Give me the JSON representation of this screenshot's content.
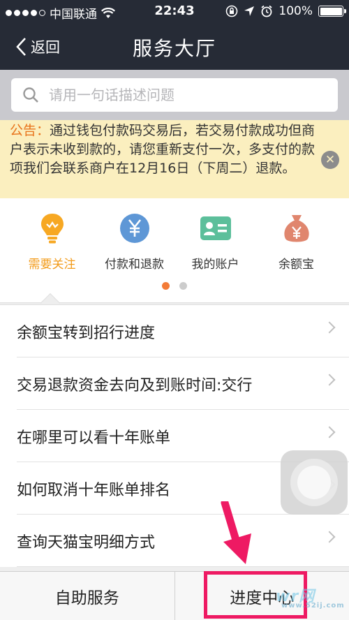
{
  "status_bar": {
    "carrier": "中国联通",
    "time": "22:43",
    "battery": "100%",
    "signal_dots": 5
  },
  "nav": {
    "back_label": "返回",
    "title": "服务大厅"
  },
  "search": {
    "placeholder": "请用一句话描述问题"
  },
  "notice": {
    "label": "公告：",
    "text": "通过钱包付款码交易后，若交易付款成功但商户表示未收到款的，请您重新支付一次，多支付的款项我们会联系商户在12月16日（下周二）退款。"
  },
  "categories": [
    {
      "label": "需要关注",
      "icon": "lightbulb-icon",
      "active": true
    },
    {
      "label": "付款和退款",
      "icon": "yuan-coin-icon",
      "active": false
    },
    {
      "label": "我的账户",
      "icon": "id-card-icon",
      "active": false
    },
    {
      "label": "余额宝",
      "icon": "money-bag-icon",
      "active": false
    }
  ],
  "pager": {
    "pages": 2,
    "current": 1
  },
  "list": [
    "余额宝转到招行进度",
    "交易退款资金去向及到账时间:交行",
    "在哪里可以看十年账单",
    "如何取消十年账单排名",
    "查询天猫宝明细方式"
  ],
  "tabs": {
    "self_service": "自助服务",
    "progress_center": "进度中心"
  },
  "watermark": {
    "text": "wr网",
    "sub": "www.52ij.com"
  },
  "colors": {
    "topbar": "#262b36",
    "accent_orange": "#f29b1a",
    "notice_bg": "#fbefbf",
    "highlight": "#ee1a63"
  }
}
